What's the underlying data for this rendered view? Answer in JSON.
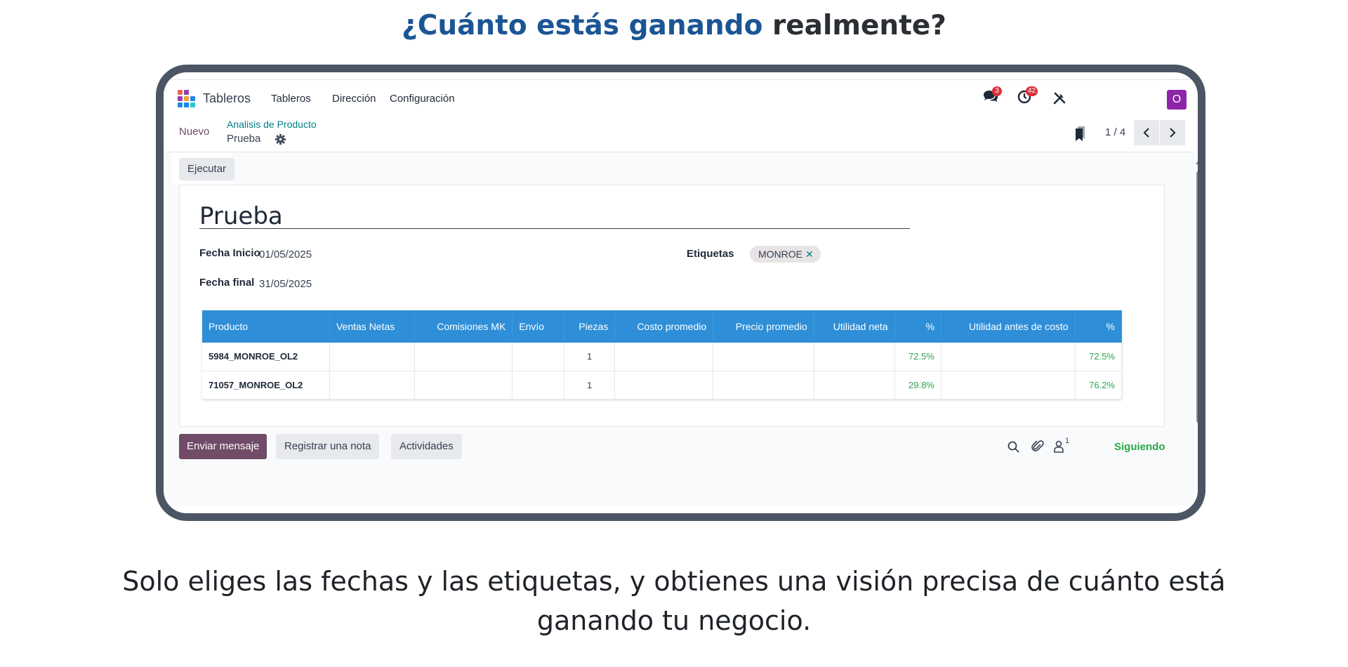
{
  "headline": {
    "part1": "¿Cuánto estás ganando",
    "part2": "realmente?"
  },
  "navbar": {
    "brand": "Tableros",
    "menu": [
      "Tableros",
      "Dirección",
      "Configuración"
    ],
    "messages_badge": "3",
    "activities_badge": "42",
    "avatar_letter": "O"
  },
  "control_panel": {
    "new_button": "Nuevo",
    "breadcrumb_parent": "Analisis de Producto",
    "breadcrumb_current": "Prueba",
    "pager": "1 / 4"
  },
  "form": {
    "execute_button": "Ejecutar",
    "title": "Prueba",
    "start_label": "Fecha Inicio",
    "start_value": "01/05/2025",
    "end_label": "Fecha final",
    "end_value": "31/05/2025",
    "tags_label": "Etiquetas",
    "tag": "MONROE"
  },
  "table": {
    "columns": [
      "Producto",
      "Ventas Netas",
      "Comisiones MK",
      "Envío",
      "Piezas",
      "Costo promedio",
      "Precio promedio",
      "Utilidad neta",
      "%",
      "Utilidad antes de costo",
      "%"
    ],
    "rows": [
      {
        "producto": "5984_MONROE_OL2",
        "piezas": "1",
        "pct_neta": "72.5%",
        "pct_antes": "72.5%"
      },
      {
        "producto": "71057_MONROE_OL2",
        "piezas": "1",
        "pct_neta": "29.8%",
        "pct_antes": "76.2%"
      }
    ]
  },
  "chatter": {
    "send_message": "Enviar mensaje",
    "log_note": "Registrar una nota",
    "activities": "Actividades",
    "followers_count": "1",
    "following": "Siguiendo"
  },
  "caption": {
    "line1": "Solo eliges las fechas y las etiquetas, y obtienes una visión precisa de cuánto está",
    "line2": "ganando tu negocio."
  },
  "colors": {
    "accent": "#714b67",
    "header_blue": "#2e8fd8",
    "teal": "#017e84",
    "positive": "#2ea44f",
    "headline_blue": "#1b5594"
  }
}
